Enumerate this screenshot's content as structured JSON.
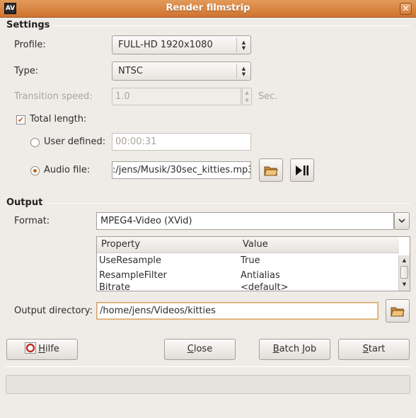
{
  "window": {
    "title": "Render filmstrip",
    "app_icon": "AV",
    "close_glyph": "✕"
  },
  "settings": {
    "section_title": "Settings",
    "profile_label": "Profile:",
    "profile_value": "FULL-HD 1920x1080",
    "type_label": "Type:",
    "type_value": "NTSC",
    "transition_label": "Transition speed:",
    "transition_value": "1.0",
    "transition_unit": "Sec.",
    "total_length_label": "Total length:",
    "total_length_checked": true,
    "user_defined_label": "User defined:",
    "user_defined_value": "00:00:31",
    "audio_file_label": "Audio file:",
    "audio_file_value": ":/jens/Musik/30sec_kitties.mp3",
    "selected_source": "audio_file"
  },
  "output": {
    "section_title": "Output",
    "format_label": "Format:",
    "format_value": "MPEG4-Video (XVid)",
    "properties": {
      "columns": [
        "Property",
        "Value"
      ],
      "rows": [
        [
          "UseResample",
          "True"
        ],
        [
          "ResampleFilter",
          "Antialias"
        ],
        [
          "Bitrate",
          "<default>"
        ]
      ]
    },
    "directory_label": "Output directory:",
    "directory_value": "/home/jens/Videos/kitties"
  },
  "buttons": {
    "help": {
      "mnemonic": "H",
      "rest": "ilfe"
    },
    "close": {
      "mnemonic": "C",
      "rest": "lose"
    },
    "batch": {
      "mnemonic": "B",
      "rest": "atch Job"
    },
    "start": {
      "mnemonic": "S",
      "rest": "tart"
    }
  },
  "icons": {
    "folder": "folder-open-icon",
    "play_pause": "play-pause-icon",
    "help": "help-lifebuoy-icon"
  },
  "colors": {
    "titlebar": "#d0732f",
    "accent": "#c2641d",
    "window_bg": "#efebe7"
  },
  "progress_fraction": 0
}
